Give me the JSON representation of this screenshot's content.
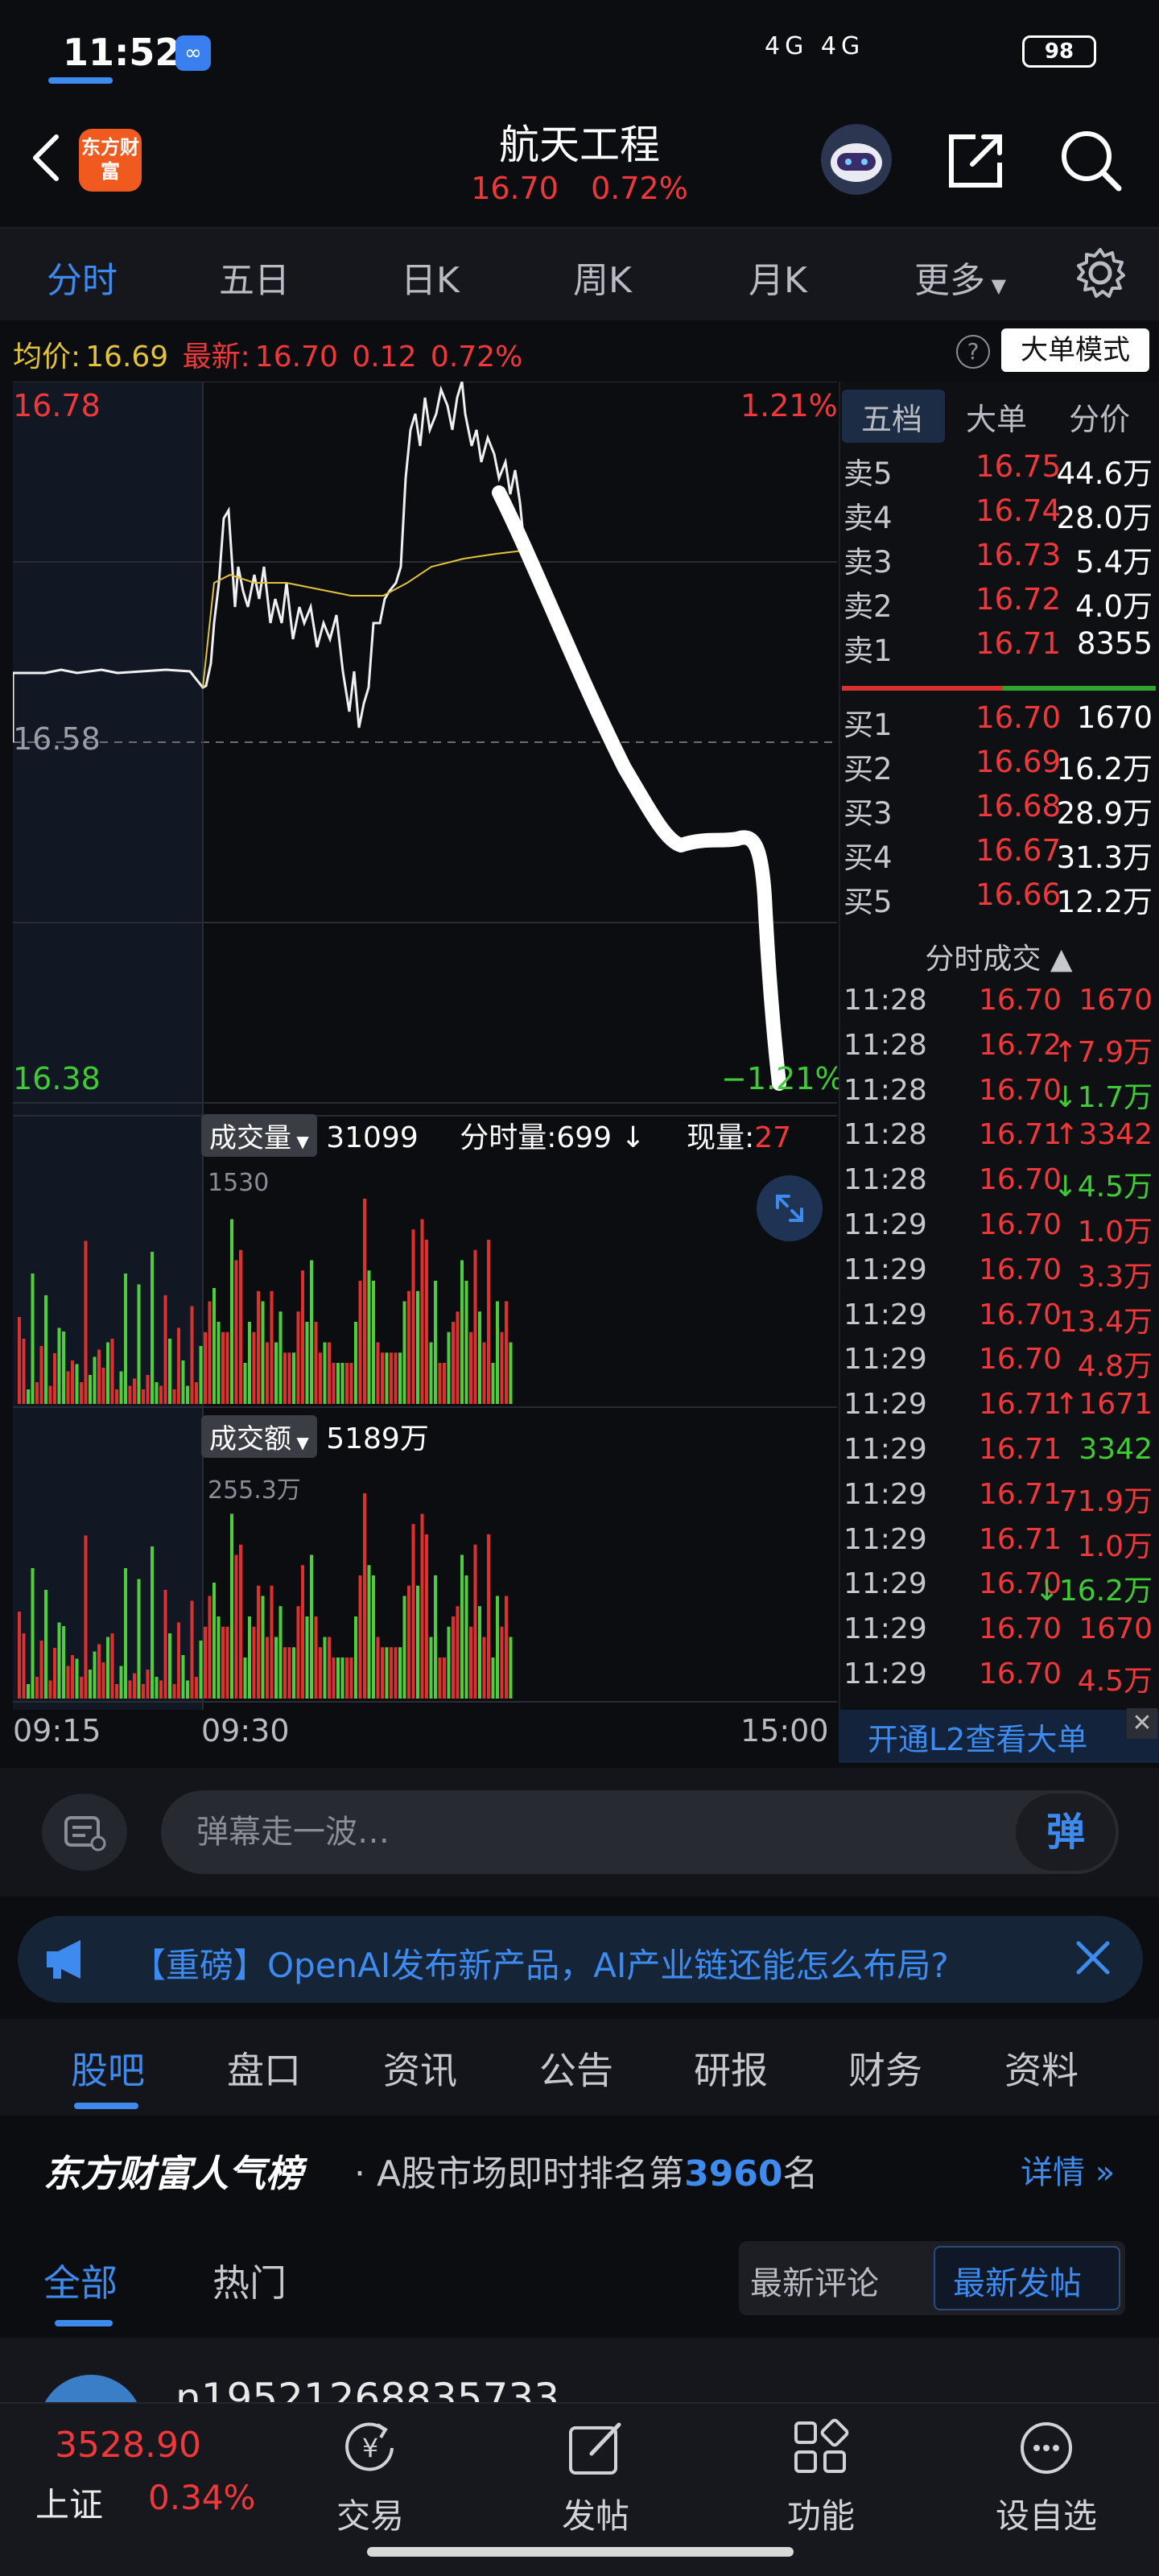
{
  "status_bar": {
    "time": "11:52",
    "network": "4G 4G",
    "battery": "98"
  },
  "header": {
    "logo_text": "东方财富",
    "title": "航天工程",
    "price": "16.70",
    "change_pct": "0.72%"
  },
  "chart_tabs": [
    "分时",
    "五日",
    "日K",
    "周K",
    "月K",
    "更多"
  ],
  "info_bar": {
    "avg_label": "均价:",
    "avg_value": "16.69",
    "latest_label": "最新:",
    "latest_value": "16.70",
    "change": "0.12",
    "change_pct": "0.72%",
    "help": "?",
    "mode_button": "大单模式"
  },
  "chart_labels": {
    "high": "16.78",
    "mid": "16.58",
    "low": "16.38",
    "high_pct": "1.21%",
    "low_pct": "−1.21%"
  },
  "volume_bar": {
    "label": "成交量",
    "value": "31099",
    "minute_label": "分时量:",
    "minute_value": "699",
    "arrow": "↓",
    "now_label": "现量:",
    "now_value": "27",
    "scale": "1530"
  },
  "amount_bar": {
    "label": "成交额",
    "value": "5189万",
    "scale": "255.3万"
  },
  "time_axis": {
    "start": "09:15",
    "open": "09:30",
    "close": "15:00"
  },
  "order_book": {
    "tabs": [
      "五档",
      "大单",
      "分价"
    ],
    "asks": [
      {
        "label": "卖5",
        "price": "16.75",
        "volume": "44.6万"
      },
      {
        "label": "卖4",
        "price": "16.74",
        "volume": "28.0万"
      },
      {
        "label": "卖3",
        "price": "16.73",
        "volume": "5.4万"
      },
      {
        "label": "卖2",
        "price": "16.72",
        "volume": "4.0万"
      },
      {
        "label": "卖1",
        "price": "16.71",
        "volume": "8355"
      }
    ],
    "bids": [
      {
        "label": "买1",
        "price": "16.70",
        "volume": "1670"
      },
      {
        "label": "买2",
        "price": "16.69",
        "volume": "16.2万"
      },
      {
        "label": "买3",
        "price": "16.68",
        "volume": "28.9万"
      },
      {
        "label": "买4",
        "price": "16.67",
        "volume": "31.3万"
      },
      {
        "label": "买5",
        "price": "16.66",
        "volume": "12.2万"
      }
    ],
    "trades_title": "分时成交 ▲",
    "trades": [
      {
        "time": "11:28",
        "price": "16.70",
        "volume": "1670",
        "dir": ""
      },
      {
        "time": "11:28",
        "price": "16.72",
        "volume": "7.9万",
        "dir": "↑"
      },
      {
        "time": "11:28",
        "price": "16.70",
        "volume": "1.7万",
        "dir": "↓"
      },
      {
        "time": "11:28",
        "price": "16.71",
        "volume": "3342",
        "dir": "↑"
      },
      {
        "time": "11:28",
        "price": "16.70",
        "volume": "4.5万",
        "dir": "↓"
      },
      {
        "time": "11:29",
        "price": "16.70",
        "volume": "1.0万",
        "dir": ""
      },
      {
        "time": "11:29",
        "price": "16.70",
        "volume": "3.3万",
        "dir": ""
      },
      {
        "time": "11:29",
        "price": "16.70",
        "volume": "13.4万",
        "dir": ""
      },
      {
        "time": "11:29",
        "price": "16.70",
        "volume": "4.8万",
        "dir": ""
      },
      {
        "time": "11:29",
        "price": "16.71",
        "volume": "1671",
        "dir": "↑"
      },
      {
        "time": "11:29",
        "price": "16.71",
        "volume": "3342",
        "dir": ""
      },
      {
        "time": "11:29",
        "price": "16.71",
        "volume": "71.9万",
        "dir": ""
      },
      {
        "time": "11:29",
        "price": "16.71",
        "volume": "1.0万",
        "dir": ""
      },
      {
        "time": "11:29",
        "price": "16.70",
        "volume": "16.2万",
        "dir": "↓"
      },
      {
        "time": "11:29",
        "price": "16.70",
        "volume": "1670",
        "dir": ""
      },
      {
        "time": "11:29",
        "price": "16.70",
        "volume": "4.5万",
        "dir": ""
      }
    ],
    "l2_banner": "开通L2查看大单"
  },
  "danmu": {
    "placeholder": "弹幕走一波…",
    "send": "弹"
  },
  "announcement": {
    "text": "【重磅】OpenAI发布新产品，AI产业链还能怎么布局?"
  },
  "section_tabs": [
    "股吧",
    "盘口",
    "资讯",
    "公告",
    "研报",
    "财务",
    "资料"
  ],
  "rank": {
    "brand": "东方财富人气榜",
    "prefix": "· A股市场即时排名第",
    "number": "3960",
    "suffix": "名",
    "detail": "详情 »"
  },
  "feed_tabs": [
    "全部",
    "热门"
  ],
  "sort": {
    "comment": "最新评论",
    "post": "最新发帖"
  },
  "post": {
    "username": "n19521268835733"
  },
  "bottom_nav": {
    "index_value": "3528.90",
    "index_name": "上证",
    "index_pct": "0.34%",
    "items": [
      "交易",
      "发帖",
      "功能",
      "设自选"
    ]
  },
  "colors": {
    "up": "#f0383a",
    "down": "#3fcb35",
    "accent": "#3d8bef",
    "avg_line": "#e3c339"
  }
}
